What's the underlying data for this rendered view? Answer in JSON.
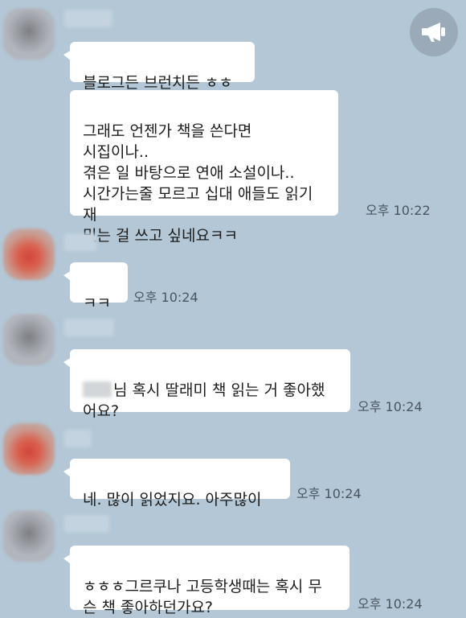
{
  "chat": {
    "messages": [
      {
        "text": "블로그든 브런치든 ㅎㅎ"
      },
      {
        "text": "그래도 언젠가 책을 쓴다면\n시집이나..\n겪은 일 바탕으로 연애 소설이나..\n시간가는줄 모르고 십대 애들도 읽기 재\n밌는 걸 쓰고 싶네요ㅋㅋ",
        "time": "오후 10:22"
      },
      {
        "text": "ㅋㅋ",
        "time": "오후 10:24"
      },
      {
        "text_suffix": "님 혹시 딸래미 책 읽는 거 좋아했\n어요?",
        "time": "오후 10:24"
      },
      {
        "text": "네. 많이  읽었지요. 아주많이",
        "time": "오후 10:24"
      },
      {
        "text": "ㅎㅎㅎ그르쿠나 고등학생때는 혹시 무\n슨 책 좋아하던가요?",
        "time": "오후 10:24"
      }
    ]
  },
  "icons": {
    "announcement": "megaphone-icon"
  },
  "colors": {
    "background": "#b3c7d6",
    "bubble": "#ffffff",
    "time_text": "#4a5661"
  }
}
